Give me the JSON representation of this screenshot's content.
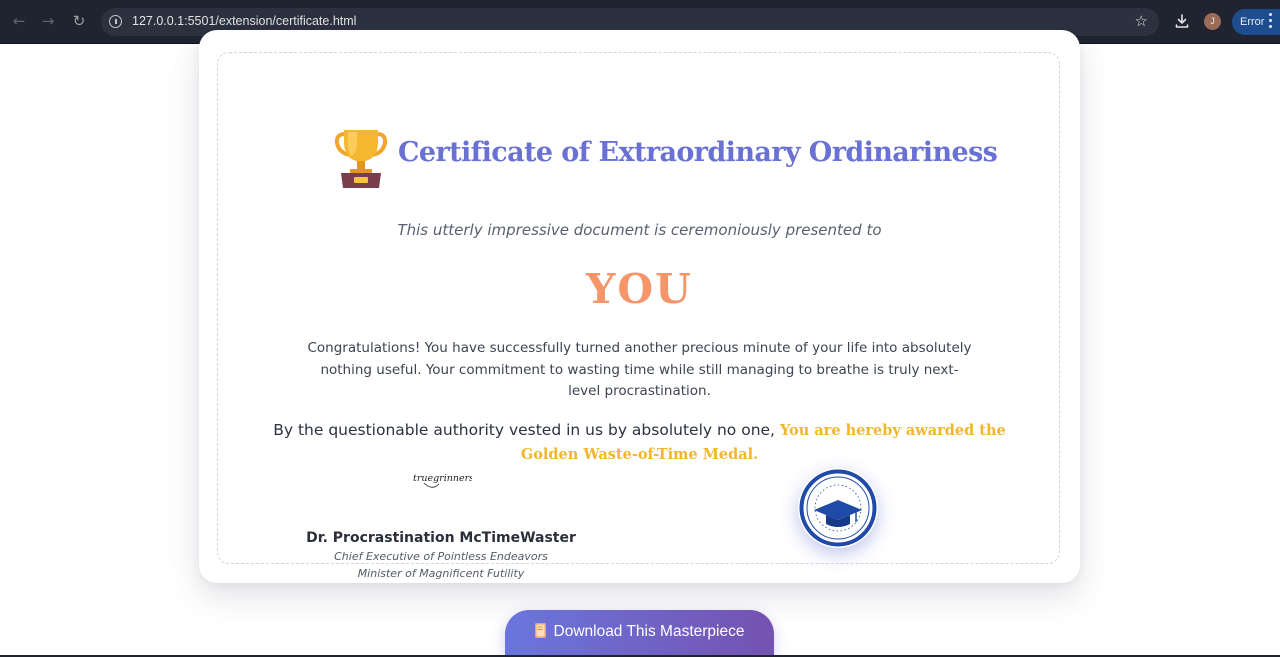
{
  "browser": {
    "url": "127.0.0.1:5501/extension/certificate.html",
    "avatar_initial": "J",
    "status_label": "Error",
    "accent": "#1d4d8f"
  },
  "certificate": {
    "title": "Certificate of Extraordinary Ordinariness",
    "presented_text": "This utterly impressive document is ceremoniously presented to",
    "recipient": "YOU",
    "body": "Congratulations! You have successfully turned another precious minute of your life into absolutely nothing useful. Your commitment to wasting time while still managing to breathe is truly next-level procrastination.",
    "authority_text": "By the questionable authority vested in us by absolutely no one,",
    "award_text": "You are hereby awarded the Golden Waste-of-Time Medal.",
    "signature": "truegrinners",
    "signer_name": "Dr. Procrastination McTimeWaster",
    "signer_title_1": "Chief Executive of Pointless Endeavors",
    "signer_title_2": "Minister of Magnificent Futility",
    "title_color": "#6a71d4",
    "recipient_color": "#f4956a",
    "award_color": "#f2b62a"
  },
  "actions": {
    "download_label": "Download This Masterpiece"
  },
  "icons": {
    "trophy": "trophy-icon",
    "seal": "graduation-cap-seal",
    "book": "book-icon"
  }
}
